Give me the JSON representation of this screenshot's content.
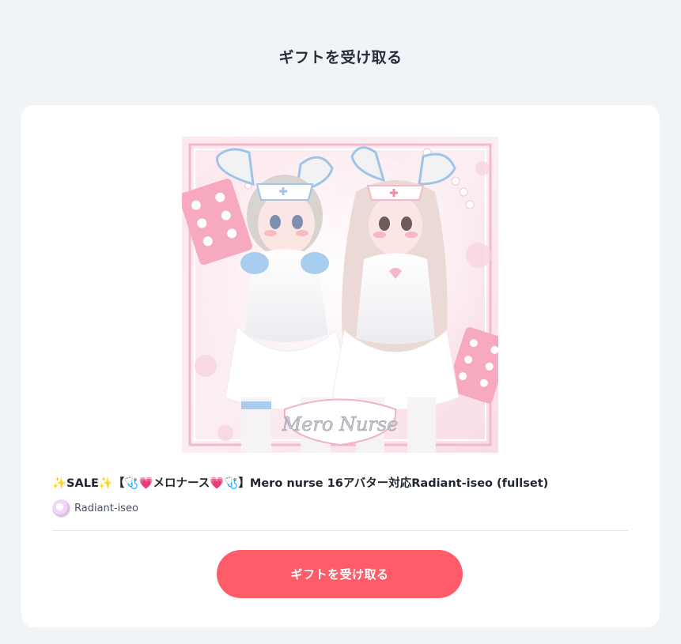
{
  "page": {
    "title": "ギフトを受け取る"
  },
  "product": {
    "title": "✨SALE✨【🩺💗メロナース💗🩺】Mero nurse 16アバター対応Radiant-iseo (fullset)",
    "image_alt": "Mero Nurse product image",
    "logo_text": "Mero Nurse",
    "shop_name": "Radiant-iseo"
  },
  "actions": {
    "receive_gift_label": "ギフトを受け取る"
  },
  "colors": {
    "background": "#f1f4f7",
    "card": "#ffffff",
    "button": "#fd5c68",
    "accent_pink": "#f6b6c9",
    "accent_blue": "#a9cdee"
  }
}
